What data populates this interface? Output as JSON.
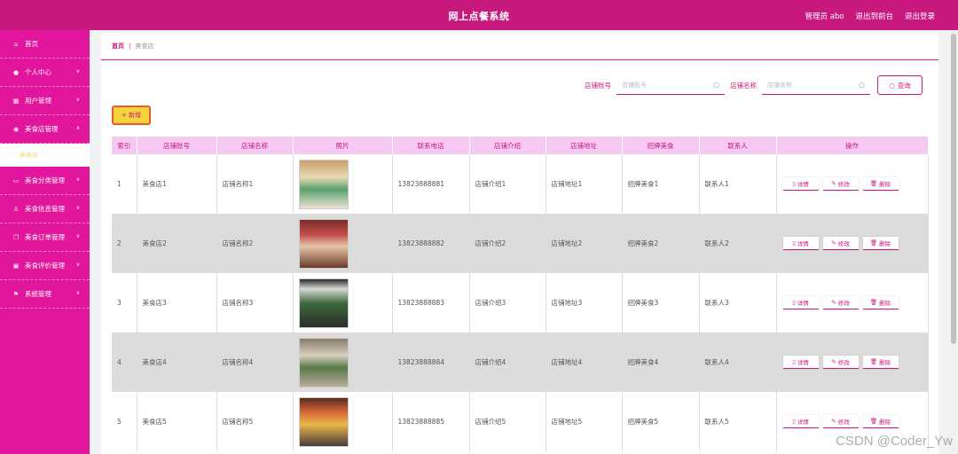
{
  "header": {
    "title": "网上点餐系统",
    "admin": "管理员 abo",
    "back_to_front": "退出到前台",
    "logout": "退出登录"
  },
  "sidebar": {
    "items": [
      {
        "label": "首页",
        "icon": "home-icon"
      },
      {
        "label": "个人中心",
        "icon": "user-icon"
      },
      {
        "label": "用户管理",
        "icon": "users-icon"
      },
      {
        "label": "美食店管理",
        "icon": "location-icon"
      },
      {
        "label": "美食分类管理",
        "icon": "category-icon"
      },
      {
        "label": "美食信息管理",
        "icon": "info-icon"
      },
      {
        "label": "美食订单管理",
        "icon": "order-icon"
      },
      {
        "label": "美食评价管理",
        "icon": "review-icon"
      },
      {
        "label": "系统管理",
        "icon": "flag-icon"
      }
    ],
    "submenu": {
      "label": "美食店"
    }
  },
  "breadcrumb": {
    "home": "首页",
    "separator": "|",
    "current": "美食店"
  },
  "search": {
    "label1": "店铺账号",
    "placeholder1": "店铺账号",
    "label2": "店铺名称",
    "placeholder2": "店铺名称",
    "button": "查询"
  },
  "add_button": "新增",
  "table": {
    "headers": [
      "索引",
      "店铺账号",
      "店铺名称",
      "照片",
      "联系电话",
      "店铺介绍",
      "店铺地址",
      "招牌美食",
      "联系人",
      "操作"
    ],
    "rows": [
      {
        "idx": "1",
        "account": "美食店1",
        "name": "店铺名称1",
        "phone": "13823888881",
        "intro": "店铺介绍1",
        "address": "店铺地址1",
        "dish": "招牌美食1",
        "contact": "联系人1"
      },
      {
        "idx": "2",
        "account": "美食店2",
        "name": "店铺名称2",
        "phone": "13823888882",
        "intro": "店铺介绍2",
        "address": "店铺地址2",
        "dish": "招牌美食2",
        "contact": "联系人2"
      },
      {
        "idx": "3",
        "account": "美食店3",
        "name": "店铺名称3",
        "phone": "13823888883",
        "intro": "店铺介绍3",
        "address": "店铺地址3",
        "dish": "招牌美食3",
        "contact": "联系人3"
      },
      {
        "idx": "4",
        "account": "美食店4",
        "name": "店铺名称4",
        "phone": "13823888884",
        "intro": "店铺介绍4",
        "address": "店铺地址4",
        "dish": "招牌美食4",
        "contact": "联系人4"
      },
      {
        "idx": "5",
        "account": "美食店5",
        "name": "店铺名称5",
        "phone": "13823888885",
        "intro": "店铺介绍5",
        "address": "店铺地址5",
        "dish": "招牌美食5",
        "contact": "联系人5"
      }
    ],
    "actions": {
      "detail": "详情",
      "edit": "修改",
      "delete": "删除"
    }
  },
  "watermark": "CSDN @Coder_Yw",
  "colors": {
    "primary": "#c8197f",
    "sidebar": "#e2169c",
    "header_row": "#f5c9f2",
    "add_button": "#f5d33c"
  }
}
